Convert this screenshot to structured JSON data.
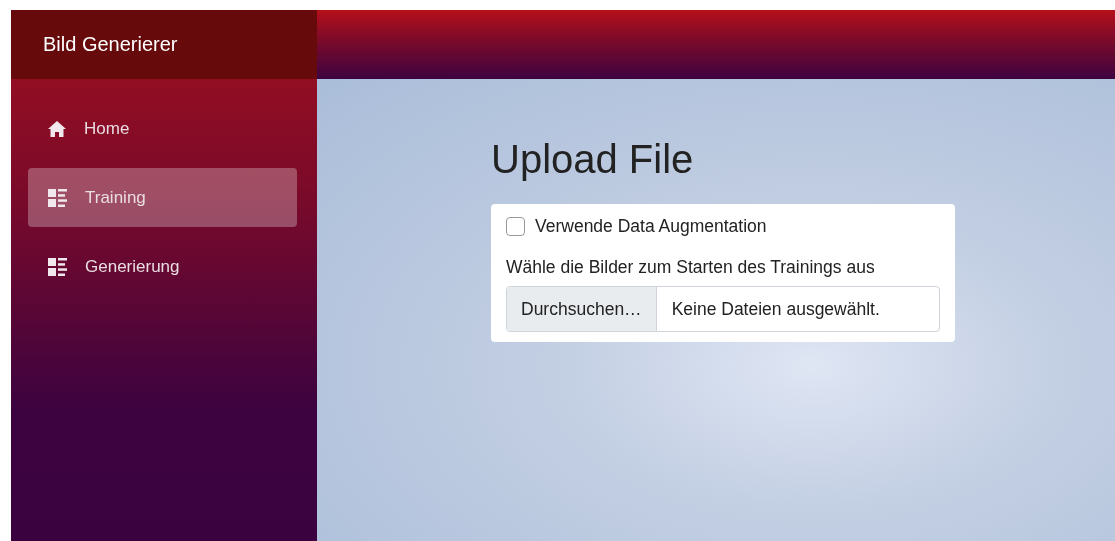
{
  "sidebar": {
    "title": "Bild Generierer",
    "items": [
      {
        "label": "Home",
        "kind": "home",
        "selected": false
      },
      {
        "label": "Training",
        "kind": "list",
        "selected": true
      },
      {
        "label": "Generierung",
        "kind": "list",
        "selected": false
      }
    ]
  },
  "main": {
    "heading": "Upload File",
    "form": {
      "checkbox": {
        "label": "Verwende Data Augmentation",
        "checked": false
      },
      "file_label": "Wähle die Bilder zum Starten des Trainings aus",
      "browse_button": "Durchsuchen…",
      "file_status": "Keine Dateien ausgewählt."
    }
  }
}
